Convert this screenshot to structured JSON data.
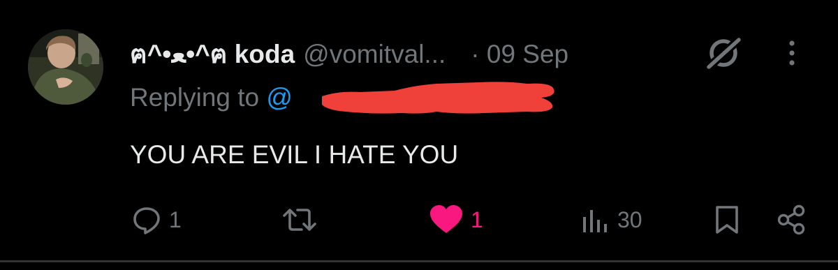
{
  "tweet": {
    "display_name": "ฅ^•ﻌ•^ฅ koda",
    "handle": "@vomitval...",
    "date": "· 09 Sep",
    "replying_prefix": "Replying to ",
    "replying_mention": "@",
    "text": "YOU ARE EVIL I HATE YOU"
  },
  "actions": {
    "reply": {
      "icon": "reply-icon",
      "count": "1"
    },
    "retweet": {
      "icon": "retweet-icon"
    },
    "like": {
      "icon": "heart-icon",
      "count": "1",
      "liked": true
    },
    "views": {
      "icon": "views-icon",
      "count": "30"
    },
    "bookmark": {
      "icon": "bookmark-icon"
    },
    "share": {
      "icon": "share-icon"
    }
  },
  "colors": {
    "background": "#000000",
    "text_primary": "#e7e9ea",
    "text_secondary": "#71767b",
    "mention_blue": "#1d9bf0",
    "like_pink": "#f91880",
    "redaction_red": "#f0403a"
  }
}
